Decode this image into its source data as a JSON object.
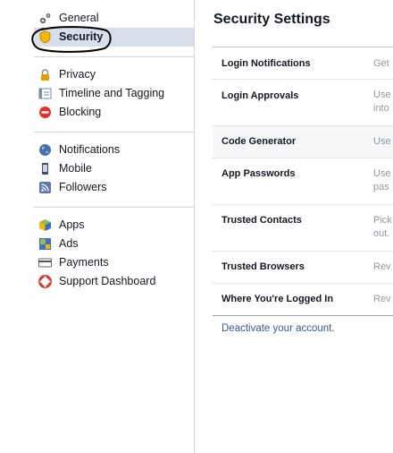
{
  "sidebar": {
    "groups": [
      {
        "items": [
          {
            "label": "General",
            "icon": "gear-icon"
          },
          {
            "label": "Security",
            "icon": "shield-badge-icon",
            "active": true
          }
        ]
      },
      {
        "items": [
          {
            "label": "Privacy",
            "icon": "lock-icon"
          },
          {
            "label": "Timeline and Tagging",
            "icon": "timeline-icon"
          },
          {
            "label": "Blocking",
            "icon": "blocking-icon"
          }
        ]
      },
      {
        "items": [
          {
            "label": "Notifications",
            "icon": "globe-icon"
          },
          {
            "label": "Mobile",
            "icon": "mobile-phone-icon"
          },
          {
            "label": "Followers",
            "icon": "rss-icon"
          }
        ]
      },
      {
        "items": [
          {
            "label": "Apps",
            "icon": "apps-cube-icon"
          },
          {
            "label": "Ads",
            "icon": "ads-icon"
          },
          {
            "label": "Payments",
            "icon": "credit-card-icon"
          },
          {
            "label": "Support Dashboard",
            "icon": "lifebuoy-icon"
          }
        ]
      }
    ]
  },
  "main": {
    "title": "Security Settings",
    "rows": [
      {
        "label": "Login Notifications",
        "desc": [
          "Get"
        ]
      },
      {
        "label": "Login Approvals",
        "desc": [
          "Use",
          "into"
        ]
      },
      {
        "label": "Code Generator",
        "desc": [
          "Use"
        ]
      },
      {
        "label": "App Passwords",
        "desc": [
          "Use",
          "pas"
        ]
      },
      {
        "label": "Trusted Contacts",
        "desc": [
          "Pick",
          "out."
        ]
      },
      {
        "label": "Trusted Browsers",
        "desc": [
          "Rev"
        ]
      },
      {
        "label": "Where You're Logged In",
        "desc": [
          "Rev"
        ]
      }
    ],
    "deactivate": "Deactivate your account."
  },
  "colors": {
    "active_bg": "#d8dfea",
    "link": "#3b5998",
    "annotation_circle": "#000000"
  }
}
